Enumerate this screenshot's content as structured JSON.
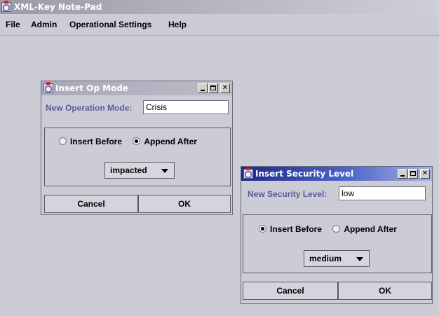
{
  "window": {
    "title": "XML-Key Note-Pad"
  },
  "menu": {
    "items": [
      "File",
      "Admin",
      "Operational Settings",
      "Help"
    ]
  },
  "dialog_op_mode": {
    "title": "Insert Op Mode",
    "field_label": "New Operation Mode:",
    "field_value": "Crisis",
    "radio_insert_before": "Insert Before",
    "radio_append_after": "Append After",
    "selected_radio": "Append After",
    "combo_value": "impacted",
    "cancel_label": "Cancel",
    "ok_label": "OK"
  },
  "dialog_security": {
    "title": "Insert Security Level",
    "field_label": "New Security Level:",
    "field_value": "low",
    "radio_insert_before": "Insert Before",
    "radio_append_after": "Append After",
    "selected_radio": "Insert Before",
    "combo_value": "medium",
    "cancel_label": "Cancel",
    "ok_label": "OK"
  },
  "colors": {
    "background": "#ccccd6",
    "label_blue": "#5a5a9a",
    "active_title": "#1c2a8c"
  }
}
